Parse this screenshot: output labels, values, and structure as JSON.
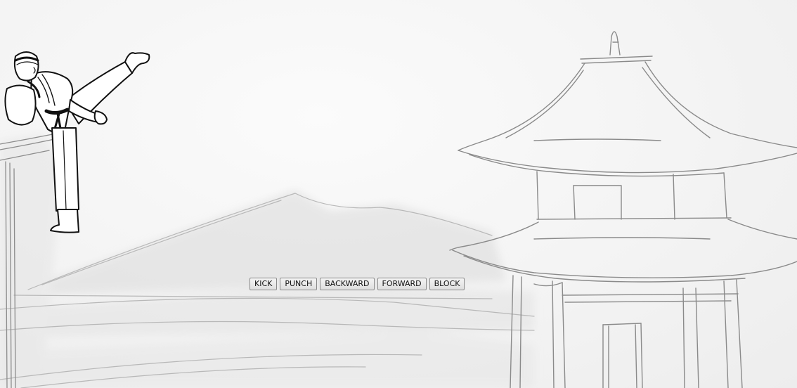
{
  "controls": [
    {
      "name": "kick-button",
      "label": "KICK"
    },
    {
      "name": "punch-button",
      "label": "PUNCH"
    },
    {
      "name": "backward-button",
      "label": "BACKWARD"
    },
    {
      "name": "forward-button",
      "label": "FORWARD"
    },
    {
      "name": "block-button",
      "label": "BLOCK"
    }
  ],
  "scene": {
    "sketch_color": "#7d7d7d",
    "fighter_color": "#111111",
    "background_color": "#f6f6f6"
  }
}
